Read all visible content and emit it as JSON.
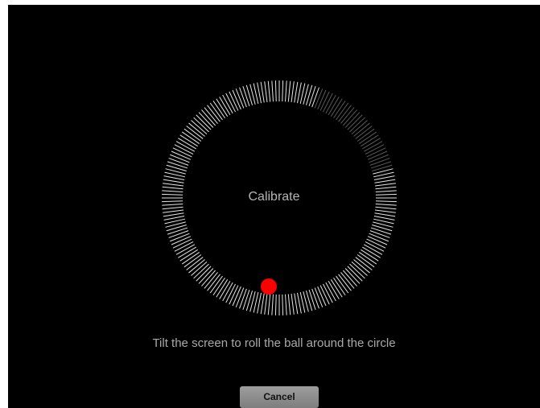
{
  "calibration": {
    "title": "Calibrate",
    "instruction": "Tilt the screen to roll the ball around the circle",
    "cancel_label": "Cancel",
    "ball_color": "#ff0000",
    "tick_color": "#ffffff",
    "background_color": "#000000"
  }
}
